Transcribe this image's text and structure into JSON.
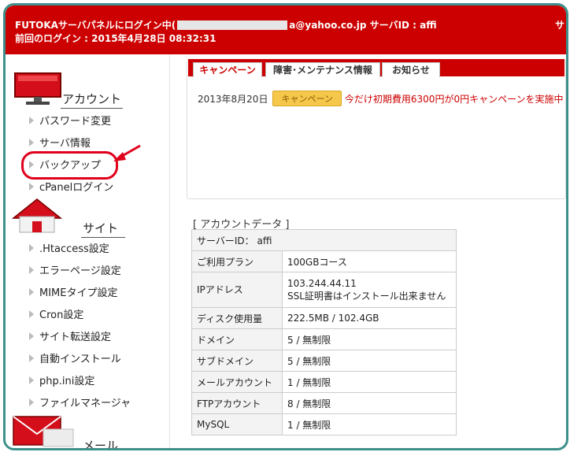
{
  "header": {
    "line1_prefix": "FUTOKAサーバパネルにログイン中(",
    "line1_suffix": "a@yahoo.co.jp サーバID : affi",
    "line2": "前回のログイン : 2015年4月28日 08:32:31",
    "right_text": "サ"
  },
  "sidebar": {
    "account_title": "アカウント",
    "account_items": [
      "パスワード変更",
      "サーバ情報",
      "バックアップ",
      "cPanelログイン"
    ],
    "site_title": "サイト",
    "site_items": [
      ".Htaccess設定",
      "エラーページ設定",
      "MIMEタイプ設定",
      "Cron設定",
      "サイト転送設定",
      "自動インストール",
      "php.ini設定",
      "ファイルマネージャ"
    ],
    "mail_title": "メール"
  },
  "tabs": [
    "キャンペーン",
    "障害･メンテナンス情報",
    "お知らせ"
  ],
  "news": {
    "date": "2013年8月20日",
    "badge": "キャンペーン",
    "message": "今だけ初期費用6300円が0円キャンペーンを実施中"
  },
  "account_data": {
    "title": "[ アカウントデータ ]",
    "server_id": "サーバーID： affi",
    "rows": [
      {
        "key": "ご利用プラン",
        "value": "100GBコース"
      },
      {
        "key": "IPアドレス",
        "value": "103.244.44.11",
        "value2": "SSL証明書はインストール出来ません"
      },
      {
        "key": "ディスク使用量",
        "value": "222.5MB / 102.4GB"
      },
      {
        "key": "ドメイン",
        "value": "5 / 無制限"
      },
      {
        "key": "サブドメイン",
        "value": "5 / 無制限"
      },
      {
        "key": "メールアカウント",
        "value": "1 / 無制限"
      },
      {
        "key": "FTPアカウント",
        "value": "8 / 無制限"
      },
      {
        "key": "MySQL",
        "value": "1 / 無制限"
      }
    ]
  },
  "colors": {
    "brand": "#cc0000",
    "frame": "#3d8f8a",
    "highlight": "#e0001b"
  }
}
